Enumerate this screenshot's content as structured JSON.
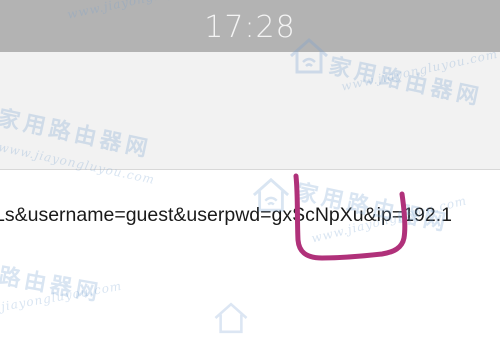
{
  "status_bar": {
    "time": "17:28"
  },
  "page": {
    "url_fragment": "Ls&username=guest&userpwd=gxScNpXu&ip=192.1"
  },
  "watermark": {
    "brand_cn": "家用路由器网",
    "brand_cn_short": "路由器网",
    "site_en": "www.jiayongluyou.com",
    "site_en_short": "jiayongluyou.com"
  },
  "annotation": {
    "color": "#b0317a"
  },
  "colors": {
    "status_bar": "#b3b3b3",
    "toolbar": "#f2f2f2",
    "content": "#ffffff",
    "watermark": "#78a0d2"
  }
}
